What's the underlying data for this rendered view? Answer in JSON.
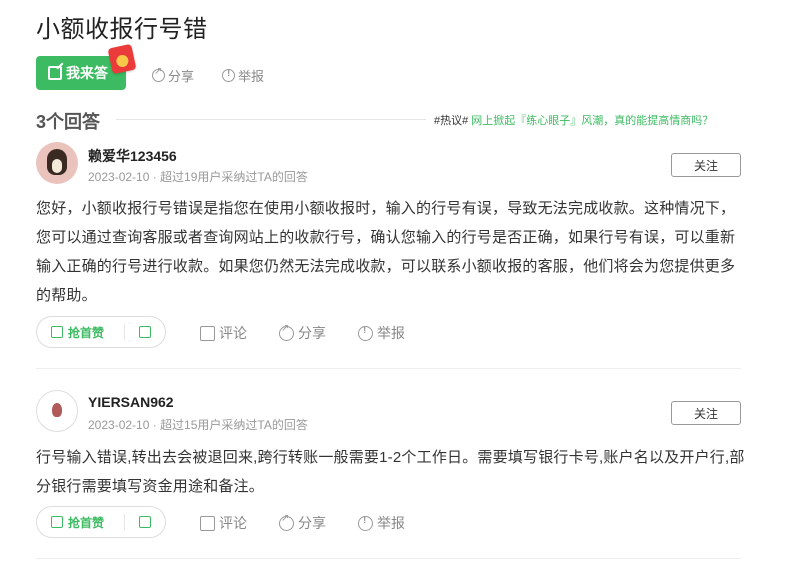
{
  "question": {
    "title": "小额收报行号错"
  },
  "top_actions": {
    "answer": "我来答",
    "share": "分享",
    "report": "举报"
  },
  "answers_header": {
    "count": "3个回答",
    "hot_tag": "#热议#",
    "hot_text": " 网上掀起『练心眼子』风潮，真的能提高情商吗？"
  },
  "answers": [
    {
      "username": "赖爱华123456",
      "meta": "2023-02-10 · 超过19用户采纳过TA的回答",
      "follow": "关注",
      "content": "您好，小额收报行号错误是指您在使用小额收报时，输入的行号有误，导致无法完成收款。这种情况下，您可以通过查询客服或者查询网站上的收款行号，确认您输入的行号是否正确，如果行号有误，可以重新输入正确的行号进行收款。如果您仍然无法完成收款，可以联系小额收报的客服，他们将会为您提供更多的帮助。",
      "like": "抢首赞",
      "comment": "评论",
      "share": "分享",
      "report": "举报"
    },
    {
      "username": "YIERSAN962",
      "meta": "2023-02-10 · 超过15用户采纳过TA的回答",
      "follow": "关注",
      "content": "行号输入错误,转出去会被退回来,跨行转账一般需要1-2个工作日。需要填写银行卡号,账户名以及开户行,部分银行需要填写资金用途和备注。",
      "like": "抢首赞",
      "comment": "评论",
      "share": "分享",
      "report": "举报"
    }
  ],
  "colors": {
    "accent": "#3dbb62",
    "redpack": "#ea3a3a"
  }
}
